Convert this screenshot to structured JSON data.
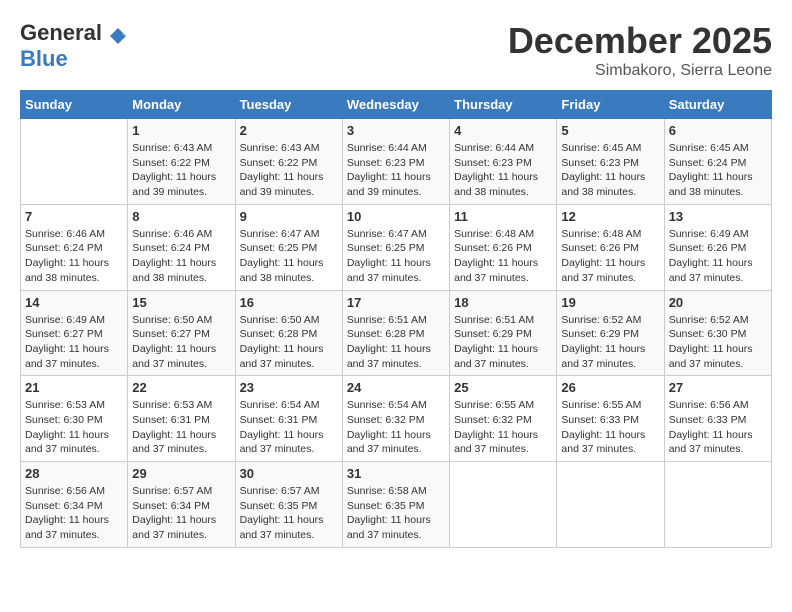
{
  "header": {
    "logo_general": "General",
    "logo_blue": "Blue",
    "month": "December 2025",
    "location": "Simbakoro, Sierra Leone"
  },
  "weekdays": [
    "Sunday",
    "Monday",
    "Tuesday",
    "Wednesday",
    "Thursday",
    "Friday",
    "Saturday"
  ],
  "weeks": [
    [
      {
        "day": "",
        "sunrise": "",
        "sunset": "",
        "daylight": ""
      },
      {
        "day": "1",
        "sunrise": "Sunrise: 6:43 AM",
        "sunset": "Sunset: 6:22 PM",
        "daylight": "Daylight: 11 hours and 39 minutes."
      },
      {
        "day": "2",
        "sunrise": "Sunrise: 6:43 AM",
        "sunset": "Sunset: 6:22 PM",
        "daylight": "Daylight: 11 hours and 39 minutes."
      },
      {
        "day": "3",
        "sunrise": "Sunrise: 6:44 AM",
        "sunset": "Sunset: 6:23 PM",
        "daylight": "Daylight: 11 hours and 39 minutes."
      },
      {
        "day": "4",
        "sunrise": "Sunrise: 6:44 AM",
        "sunset": "Sunset: 6:23 PM",
        "daylight": "Daylight: 11 hours and 38 minutes."
      },
      {
        "day": "5",
        "sunrise": "Sunrise: 6:45 AM",
        "sunset": "Sunset: 6:23 PM",
        "daylight": "Daylight: 11 hours and 38 minutes."
      },
      {
        "day": "6",
        "sunrise": "Sunrise: 6:45 AM",
        "sunset": "Sunset: 6:24 PM",
        "daylight": "Daylight: 11 hours and 38 minutes."
      }
    ],
    [
      {
        "day": "7",
        "sunrise": "Sunrise: 6:46 AM",
        "sunset": "Sunset: 6:24 PM",
        "daylight": "Daylight: 11 hours and 38 minutes."
      },
      {
        "day": "8",
        "sunrise": "Sunrise: 6:46 AM",
        "sunset": "Sunset: 6:24 PM",
        "daylight": "Daylight: 11 hours and 38 minutes."
      },
      {
        "day": "9",
        "sunrise": "Sunrise: 6:47 AM",
        "sunset": "Sunset: 6:25 PM",
        "daylight": "Daylight: 11 hours and 38 minutes."
      },
      {
        "day": "10",
        "sunrise": "Sunrise: 6:47 AM",
        "sunset": "Sunset: 6:25 PM",
        "daylight": "Daylight: 11 hours and 37 minutes."
      },
      {
        "day": "11",
        "sunrise": "Sunrise: 6:48 AM",
        "sunset": "Sunset: 6:26 PM",
        "daylight": "Daylight: 11 hours and 37 minutes."
      },
      {
        "day": "12",
        "sunrise": "Sunrise: 6:48 AM",
        "sunset": "Sunset: 6:26 PM",
        "daylight": "Daylight: 11 hours and 37 minutes."
      },
      {
        "day": "13",
        "sunrise": "Sunrise: 6:49 AM",
        "sunset": "Sunset: 6:26 PM",
        "daylight": "Daylight: 11 hours and 37 minutes."
      }
    ],
    [
      {
        "day": "14",
        "sunrise": "Sunrise: 6:49 AM",
        "sunset": "Sunset: 6:27 PM",
        "daylight": "Daylight: 11 hours and 37 minutes."
      },
      {
        "day": "15",
        "sunrise": "Sunrise: 6:50 AM",
        "sunset": "Sunset: 6:27 PM",
        "daylight": "Daylight: 11 hours and 37 minutes."
      },
      {
        "day": "16",
        "sunrise": "Sunrise: 6:50 AM",
        "sunset": "Sunset: 6:28 PM",
        "daylight": "Daylight: 11 hours and 37 minutes."
      },
      {
        "day": "17",
        "sunrise": "Sunrise: 6:51 AM",
        "sunset": "Sunset: 6:28 PM",
        "daylight": "Daylight: 11 hours and 37 minutes."
      },
      {
        "day": "18",
        "sunrise": "Sunrise: 6:51 AM",
        "sunset": "Sunset: 6:29 PM",
        "daylight": "Daylight: 11 hours and 37 minutes."
      },
      {
        "day": "19",
        "sunrise": "Sunrise: 6:52 AM",
        "sunset": "Sunset: 6:29 PM",
        "daylight": "Daylight: 11 hours and 37 minutes."
      },
      {
        "day": "20",
        "sunrise": "Sunrise: 6:52 AM",
        "sunset": "Sunset: 6:30 PM",
        "daylight": "Daylight: 11 hours and 37 minutes."
      }
    ],
    [
      {
        "day": "21",
        "sunrise": "Sunrise: 6:53 AM",
        "sunset": "Sunset: 6:30 PM",
        "daylight": "Daylight: 11 hours and 37 minutes."
      },
      {
        "day": "22",
        "sunrise": "Sunrise: 6:53 AM",
        "sunset": "Sunset: 6:31 PM",
        "daylight": "Daylight: 11 hours and 37 minutes."
      },
      {
        "day": "23",
        "sunrise": "Sunrise: 6:54 AM",
        "sunset": "Sunset: 6:31 PM",
        "daylight": "Daylight: 11 hours and 37 minutes."
      },
      {
        "day": "24",
        "sunrise": "Sunrise: 6:54 AM",
        "sunset": "Sunset: 6:32 PM",
        "daylight": "Daylight: 11 hours and 37 minutes."
      },
      {
        "day": "25",
        "sunrise": "Sunrise: 6:55 AM",
        "sunset": "Sunset: 6:32 PM",
        "daylight": "Daylight: 11 hours and 37 minutes."
      },
      {
        "day": "26",
        "sunrise": "Sunrise: 6:55 AM",
        "sunset": "Sunset: 6:33 PM",
        "daylight": "Daylight: 11 hours and 37 minutes."
      },
      {
        "day": "27",
        "sunrise": "Sunrise: 6:56 AM",
        "sunset": "Sunset: 6:33 PM",
        "daylight": "Daylight: 11 hours and 37 minutes."
      }
    ],
    [
      {
        "day": "28",
        "sunrise": "Sunrise: 6:56 AM",
        "sunset": "Sunset: 6:34 PM",
        "daylight": "Daylight: 11 hours and 37 minutes."
      },
      {
        "day": "29",
        "sunrise": "Sunrise: 6:57 AM",
        "sunset": "Sunset: 6:34 PM",
        "daylight": "Daylight: 11 hours and 37 minutes."
      },
      {
        "day": "30",
        "sunrise": "Sunrise: 6:57 AM",
        "sunset": "Sunset: 6:35 PM",
        "daylight": "Daylight: 11 hours and 37 minutes."
      },
      {
        "day": "31",
        "sunrise": "Sunrise: 6:58 AM",
        "sunset": "Sunset: 6:35 PM",
        "daylight": "Daylight: 11 hours and 37 minutes."
      },
      {
        "day": "",
        "sunrise": "",
        "sunset": "",
        "daylight": ""
      },
      {
        "day": "",
        "sunrise": "",
        "sunset": "",
        "daylight": ""
      },
      {
        "day": "",
        "sunrise": "",
        "sunset": "",
        "daylight": ""
      }
    ]
  ]
}
